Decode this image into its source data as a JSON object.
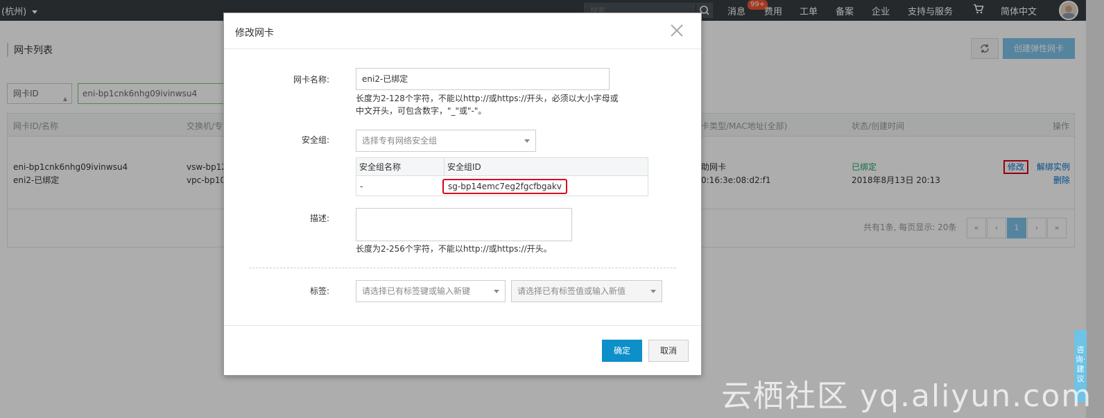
{
  "topbar": {
    "region": "(杭州)",
    "search_placeholder": "搜索",
    "badge": "99+",
    "nav": [
      "消息",
      "费用",
      "工单",
      "备案",
      "企业",
      "支持与服务",
      "简体中文"
    ]
  },
  "page": {
    "title": "网卡列表",
    "create_button": "创建弹性网卡",
    "filter_select": "网卡ID",
    "filter_value": "eni-bp1cnk6nhg09ivinwsu4",
    "columns": [
      "网卡ID/名称",
      "交换机/专",
      "卡类型/MAC地址(全部)",
      "状态/创建时间",
      "操作"
    ],
    "row": {
      "id": "eni-bp1cnk6nhg09ivinwsu4",
      "name": "eni2-已绑定",
      "vsw": "vsw-bp12",
      "vpc": "vpc-bp10",
      "type": "助网卡",
      "mac": "0:16:3e:08:d2:f1",
      "status": "已绑定",
      "created": "2018年8月13日 20:13",
      "actions": [
        "修改",
        "解绑实例",
        "删除"
      ]
    },
    "summary": "共有1条, 每页显示: 20条",
    "pagination": [
      "«",
      "‹",
      "1",
      "›",
      "»"
    ]
  },
  "modal": {
    "title": "修改网卡",
    "name_label": "网卡名称:",
    "name_value": "eni2-已绑定",
    "name_help_1": "长度为2-128个字符，不能以http://或https://开头，必须以大小字母或",
    "name_help_2": "中文开头，可包含数字，\"_\"或\"-\"。",
    "sg_label": "安全组:",
    "sg_placeholder": "选择专有网络安全组",
    "sg_col_name": "安全组名称",
    "sg_col_id": "安全组ID",
    "sg_row_name": "-",
    "sg_row_id": "sg-bp14emc7eg2fgcfbgakv",
    "desc_label": "描述:",
    "desc_help": "长度为2-256个字符，不能以http://或https://开头。",
    "tag_label": "标签:",
    "tag_key_placeholder": "请选择已有标签键或输入新键",
    "tag_value_placeholder": "请选择已有标签值或输入新值",
    "ok": "确定",
    "cancel": "取消"
  },
  "watermark": "云栖社区 yq.aliyun.com",
  "side_tab": "咨询·建议"
}
